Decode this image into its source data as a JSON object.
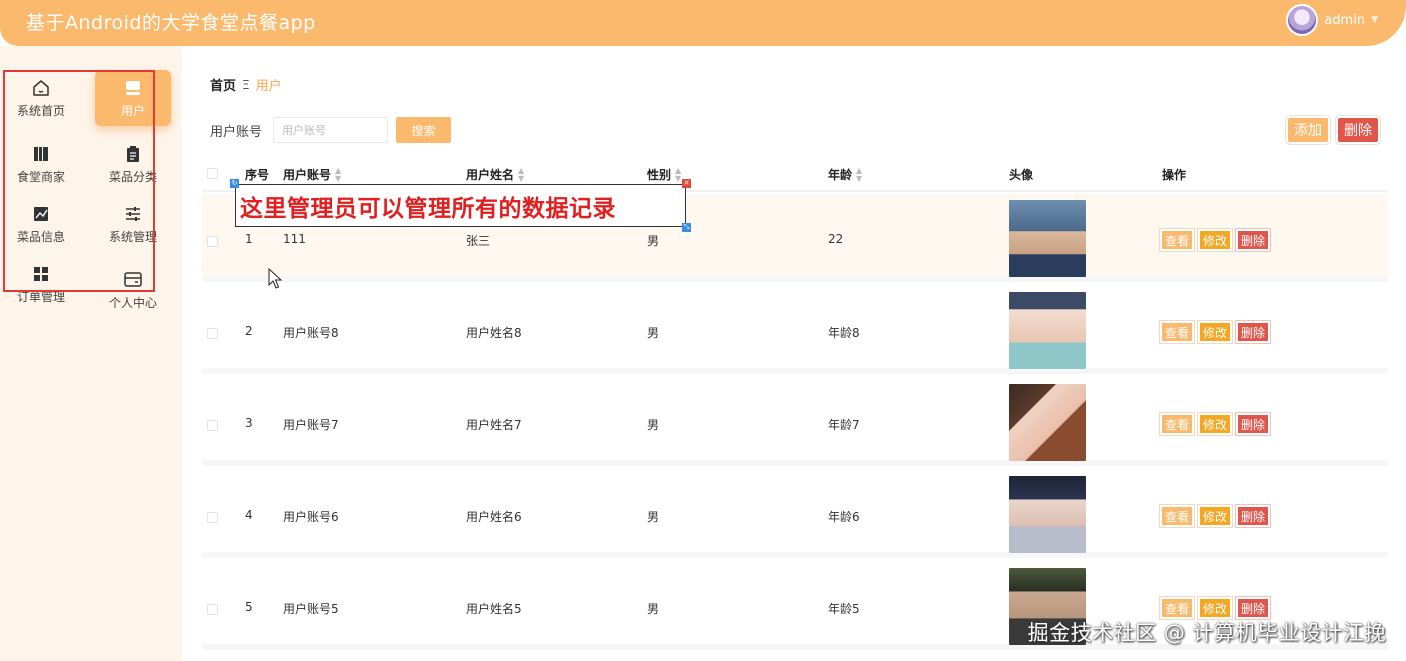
{
  "header": {
    "title": "基于Android的大学食堂点餐app",
    "user_name": "admin"
  },
  "sidebar": {
    "items": [
      {
        "label": "系统首页",
        "icon": "home-icon"
      },
      {
        "label": "用户",
        "icon": "user-icon",
        "active": true
      },
      {
        "label": "食堂商家",
        "icon": "book-icon"
      },
      {
        "label": "菜品分类",
        "icon": "clipboard-icon"
      },
      {
        "label": "菜品信息",
        "icon": "chart-icon"
      },
      {
        "label": "系统管理",
        "icon": "sliders-icon"
      },
      {
        "label": "订单管理",
        "icon": "grid-icon"
      },
      {
        "label": "个人中心",
        "icon": "card-icon"
      }
    ]
  },
  "breadcrumb": {
    "home": "首页",
    "separator": "Ξ",
    "current": "用户"
  },
  "search": {
    "label": "用户账号",
    "placeholder": "用户账号",
    "button": "搜索"
  },
  "toolbar": {
    "add_label": "添加",
    "delete_label": "删除"
  },
  "table": {
    "columns": [
      "序号",
      "用户账号",
      "用户姓名",
      "性别",
      "年龄",
      "头像",
      "操作"
    ],
    "rows": [
      {
        "index": "1",
        "account": "111",
        "name": "张三",
        "gender": "男",
        "age": "22"
      },
      {
        "index": "2",
        "account": "用户账号8",
        "name": "用户姓名8",
        "gender": "男",
        "age": "年龄8"
      },
      {
        "index": "3",
        "account": "用户账号7",
        "name": "用户姓名7",
        "gender": "男",
        "age": "年龄7"
      },
      {
        "index": "4",
        "account": "用户账号6",
        "name": "用户姓名6",
        "gender": "男",
        "age": "年龄6"
      },
      {
        "index": "5",
        "account": "用户账号5",
        "name": "用户姓名5",
        "gender": "男",
        "age": "年龄5"
      }
    ],
    "actions": {
      "view": "查看",
      "edit": "修改",
      "delete": "删除"
    }
  },
  "annotation": {
    "text": "这里管理员可以管理所有的数据记录"
  },
  "watermark": "掘金技术社区 @ 计算机毕业设计江挽",
  "colors": {
    "accent": "#fbb96e",
    "danger": "#e0564b",
    "annotation_text": "#e02020"
  }
}
